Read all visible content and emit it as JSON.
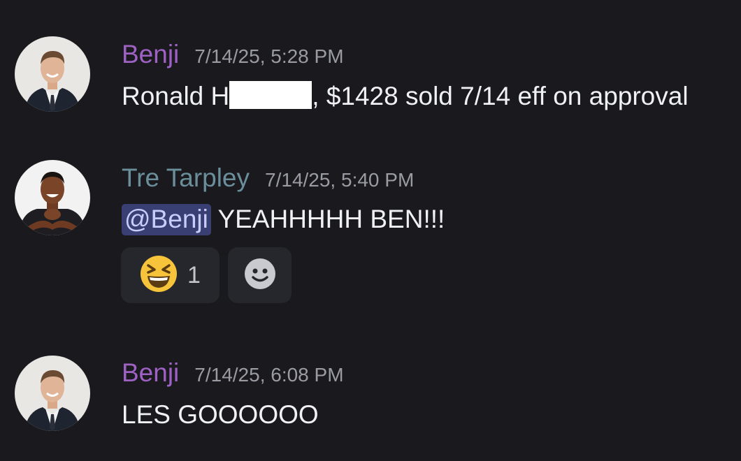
{
  "messages": [
    {
      "username": "Benji",
      "username_color": "#9d62c4",
      "timestamp": "7/14/25, 5:28 PM",
      "text_before_redaction": "Ronald H",
      "text_after_redaction": ", $1428 sold 7/14 eff on approval",
      "avatar_icon": "benji-avatar"
    },
    {
      "username": "Tre Tarpley",
      "username_color": "#6b8e9b",
      "timestamp": "7/14/25, 5:40 PM",
      "mention": "@Benji",
      "text": " YEAHHHHH BEN!!!",
      "avatar_icon": "tre-avatar",
      "reactions": [
        {
          "emoji": "laughing-emoji",
          "count": "1"
        }
      ],
      "add_reaction_icon": "smiley-add-reaction-icon"
    },
    {
      "username": "Benji",
      "username_color": "#9d62c4",
      "timestamp": "7/14/25, 6:08 PM",
      "text": "LES GOOOOOO",
      "avatar_icon": "benji-avatar"
    }
  ]
}
